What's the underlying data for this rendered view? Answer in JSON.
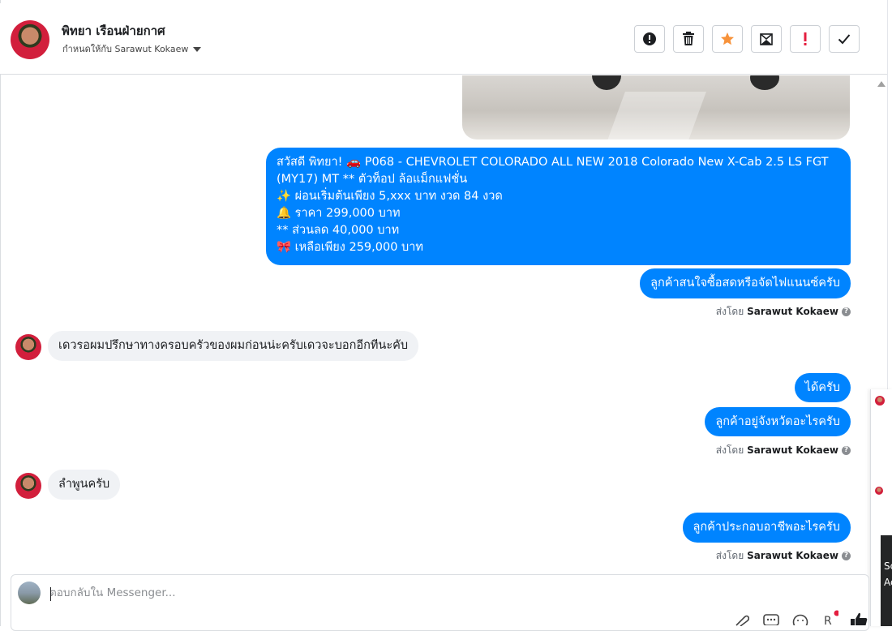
{
  "header": {
    "contact_name": "พิทยา เรือนฝ่ายกาศ",
    "assigned_to": "กำหนดให้กับ Sarawut Kokaew",
    "actions": [
      "alert-circle",
      "trash",
      "star",
      "mark-unread",
      "spam",
      "done"
    ],
    "star_color": "#f7923a",
    "spam_color": "#e41e3f"
  },
  "messages": {
    "big_lines": [
      "สวัสดี พิทยา! 🚗 P068 - CHEVROLET COLORADO ALL NEW 2018 Colorado New X-Cab 2.5 LS FGT",
      "(MY17) MT  ** ตัวท็อป ล้อแม็กแฟชั่น",
      "✨ ผ่อนเริ่มต้นเพียง 5,xxx บาท งวด 84 งวด",
      "🔔  ราคา 299,000 บาท",
      "** ส่วนลด 40,000 บาท",
      "🎀 เหลือเพียง 259,000 บาท"
    ],
    "out_1": "ลูกค้าสนใจซื้อสดหรือจัดไฟแนนซ์ครับ",
    "sent_by_label": "ส่งโดย",
    "sent_by_name": "Sarawut Kokaew",
    "in_1": "เดวรอผมปรึกษาทางครอบครัวของผมก่อนน่ะครับเดวจะบอกอีกทีนะคับ",
    "out_2": "ได้ครับ",
    "out_3": "ลูกค้าอยู่จังหวัดอะไรครับ",
    "in_2": "ลำพูนครับ",
    "out_4": "ลูกค้าประกอบอาชีพอะไรครับ",
    "bubble_color": "#0084ff"
  },
  "composer": {
    "placeholder": "ตอบกลับใน Messenger...",
    "icons": [
      "attachment-icon",
      "saved-reply-icon",
      "emoji-icon",
      "payment-icon",
      "like-icon"
    ]
  },
  "side_panel": {
    "text_1": "Sc",
    "text_2": "Ac"
  }
}
